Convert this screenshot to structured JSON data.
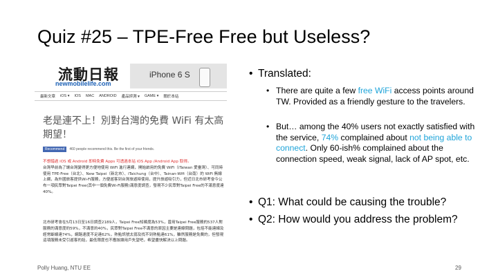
{
  "slide": {
    "title": "Quiz #25 – TPE-Free Free but Useless?",
    "footer_author": "Polly Huang, NTU EE",
    "page_number": "29"
  },
  "screenshot": {
    "logo_cn": "流動日報",
    "logo_url": "newmobilelife.com",
    "ad_text": "iPhone 6 S",
    "nav_items": [
      "最新文章",
      "iOS ▾",
      "IOS",
      "MAC",
      "ANDROID",
      "產品評測 ▾",
      "GAME ▾",
      "關於本站"
    ],
    "headline": "老是連不上！別對台灣的免費 WiFi 有太高期望！",
    "fb_button": "Recommend",
    "fb_text": "460 people recommend this. Be the first of your friends.",
    "para1_red": "不想錯過 iOS 或 Android 即時免費 Apps 可透過本站 iOS App /Android App 取得。",
    "para1": "台灣早前為了讓台灣變得更方便地使用 WiFi 進行連網，開始啟用的免費 WiFi（iTaiwan 愛臺灣）、可同時使用 TPE-Free（台北）、New Taipei（新北市）、iTaichung（台中）、Tainan-Wifi（台南）的 WiFi 無線上網，為外國旅客提供Wi-Fi服務，方便遊客到台灣旅遊時使用，提升旅遊吸引力，但近日北市研考會今公布一項民眾對Taipei Free(其中一個免費Wi-Fi服務)滿意度調查，發現不少民眾對Taipei Free的不滿意度達40%。",
    "para2": "北市研考會在5月13日至16日調查2189人，Taipei Free知曉度為53%，曾用Taipei Free服務的537人對服務的滿意度約59%，不滿意約40%，民眾對Taipei Free不滿意的原因主要是連線問題，包括不能連線及經常斷線達74%，網路速度不足達62%，熱點訊號太弱及找不到熱點達61%，雖然服務是免費的，但發現這項服務未受引遊客的話，最低限度也不應該讓用戶失望吧，希望盡快解決以上問題。"
  },
  "content": {
    "translated_label": "Translated:",
    "sub1_a": "There are quite a few ",
    "sub1_hl": "free WiFi",
    "sub1_b": " access points around TW. Provided  as a friendly gesture to the travelers.",
    "sub2_a": "But… among the 40% users not exactly satisfied with the service, ",
    "sub2_hl1": "74%",
    "sub2_b": " complained about ",
    "sub2_hl2": "not being able to connect",
    "sub2_c": ". Only 60-ish% complained about the connection speed, weak signal, lack of AP spot, etc.",
    "q1": "Q1: What could be causing the trouble?",
    "q2": "Q2: How would you address the problem?"
  },
  "colors": {
    "highlight": "#1ea4d9",
    "red_text": "#dd3333"
  }
}
